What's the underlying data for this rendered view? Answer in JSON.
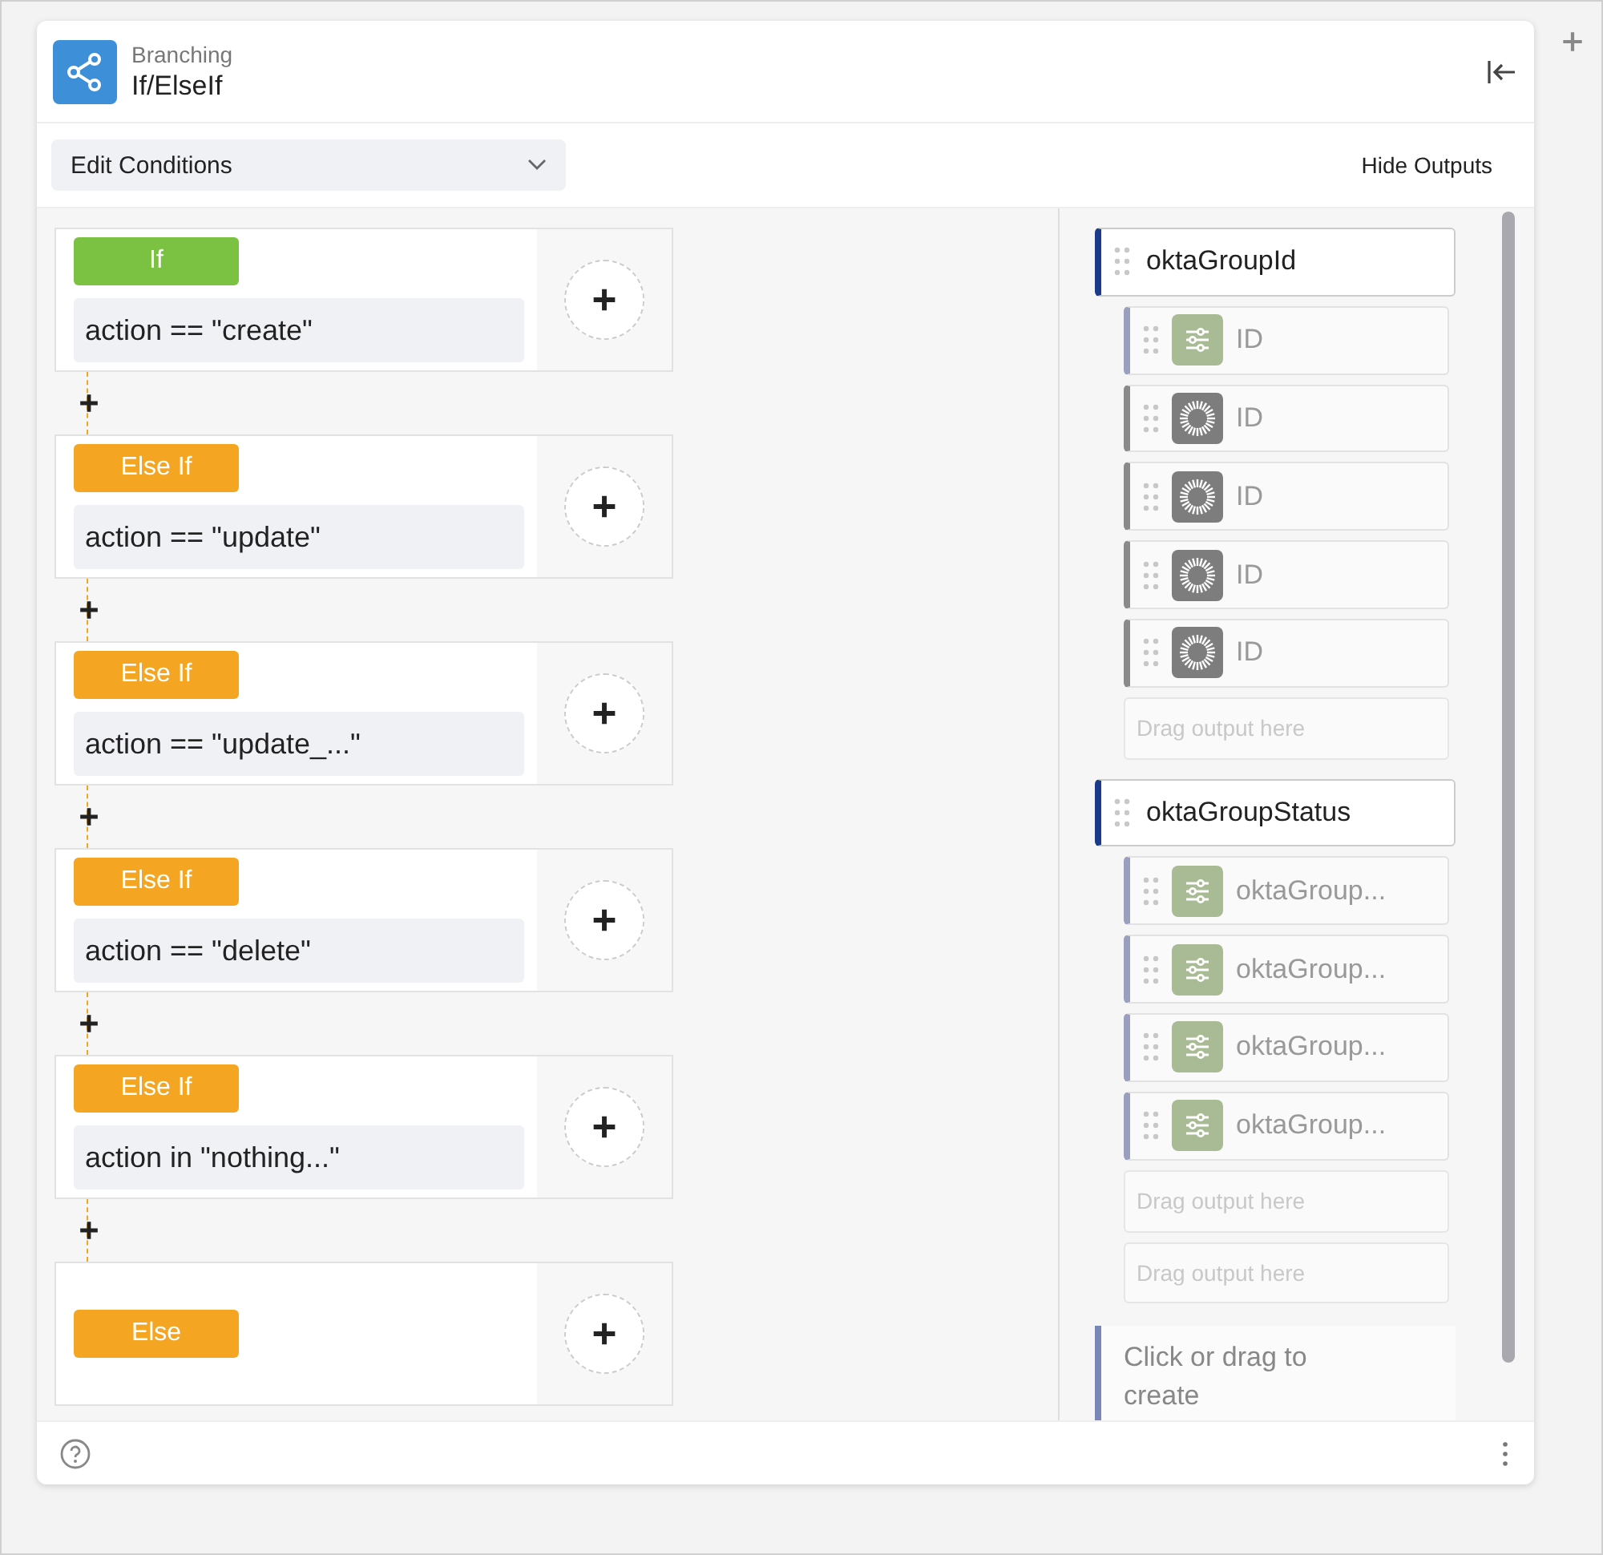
{
  "header": {
    "category": "Branching",
    "title": "If/ElseIf"
  },
  "toolbar": {
    "dropdown": "Edit Conditions",
    "toggle": "Hide Outputs"
  },
  "conditions": [
    {
      "kind": "if",
      "label": "If",
      "expression": "action == \"create\""
    },
    {
      "kind": "elseif",
      "label": "Else If",
      "expression": "action == \"update\""
    },
    {
      "kind": "elseif",
      "label": "Else If",
      "expression": "action == \"update_...\""
    },
    {
      "kind": "elseif",
      "label": "Else If",
      "expression": "action == \"delete\""
    },
    {
      "kind": "elseif",
      "label": "Else If",
      "expression": "action in \"nothing...\""
    },
    {
      "kind": "else",
      "label": "Else"
    }
  ],
  "outputs": [
    {
      "name": "oktaGroupId",
      "items": [
        {
          "kind": "property",
          "label": "ID"
        },
        {
          "kind": "source",
          "label": "ID"
        },
        {
          "kind": "source",
          "label": "ID"
        },
        {
          "kind": "source",
          "label": "ID"
        },
        {
          "kind": "source",
          "label": "ID"
        }
      ],
      "placeholders": [
        "Drag output here"
      ]
    },
    {
      "name": "oktaGroupStatus",
      "items": [
        {
          "kind": "property",
          "label": "oktaGroup..."
        },
        {
          "kind": "property",
          "label": "oktaGroup..."
        },
        {
          "kind": "property",
          "label": "oktaGroup..."
        },
        {
          "kind": "property",
          "label": "oktaGroup..."
        }
      ],
      "placeholders": [
        "Drag output here",
        "Drag output here"
      ]
    }
  ],
  "create_card": "Click or drag to create"
}
